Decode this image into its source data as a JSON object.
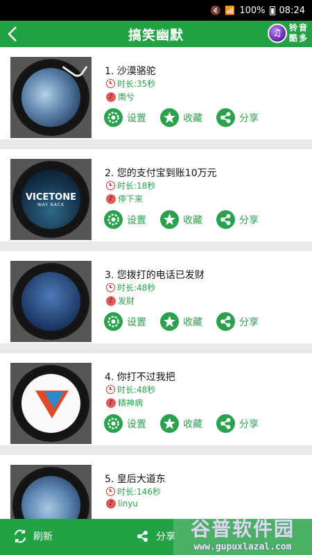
{
  "status_bar": {
    "battery": "100%",
    "time": "08:24"
  },
  "app_bar": {
    "title": "搞笑幽默",
    "logo_chars": [
      "铃",
      "音",
      "酷",
      "多"
    ]
  },
  "songs": [
    {
      "title": "1. 沙漠骆驼",
      "duration": "时长:35秒",
      "singer": "南兮"
    },
    {
      "title": "2. 您的支付宝到账10万元",
      "duration": "时长:18秒",
      "singer": "停下来",
      "cover_text": "VICETONE",
      "cover_subtext": "WAY BACK"
    },
    {
      "title": "3. 您拨打的电话已发财",
      "duration": "时长:48秒",
      "singer": "发财"
    },
    {
      "title": "4. 你打不过我把",
      "duration": "时长:48秒",
      "singer": "精神病"
    },
    {
      "title": "5. 皇后大道东",
      "duration": "时长:146秒",
      "singer": "linyu"
    }
  ],
  "actions": {
    "set": "设置",
    "favorite": "收藏",
    "share": "分享"
  },
  "bottom_bar": {
    "refresh": "刷新",
    "share": "分享"
  },
  "watermark": {
    "main": "谷普软件园",
    "sub": "www.gupuxlazal.com"
  },
  "colors": {
    "primary_green": "#22a244",
    "accent_green": "#2aa14c",
    "clock_red": "#d32f2f"
  }
}
